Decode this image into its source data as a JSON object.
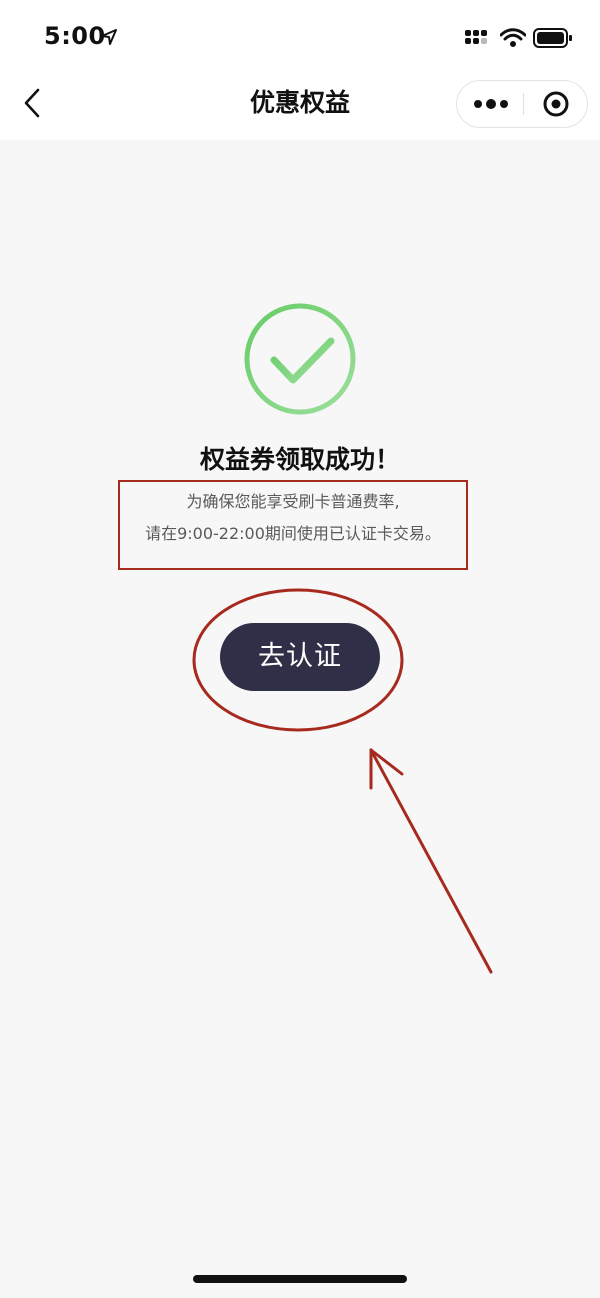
{
  "status_bar": {
    "time": "5:00",
    "icons": [
      "location-arrow-icon",
      "signal-icon",
      "wifi-icon",
      "battery-icon"
    ]
  },
  "nav": {
    "title": "优惠权益",
    "back_icon": "chevron-left-icon",
    "capsule_icons": [
      "more-dots-icon",
      "target-icon"
    ]
  },
  "content": {
    "icon": "check-circle-icon",
    "title": "权益券领取成功！",
    "desc_line1": "为确保您能享受刷卡普通费率,",
    "desc_line2": "请在9:00-22:00期间使用已认证卡交易。",
    "button_label": "去认证"
  },
  "colors": {
    "page_bg": "#f7f7f7",
    "button_bg": "#2f2f47",
    "success_green": "#7ad67a",
    "annotation_red": "#a72a1f"
  }
}
